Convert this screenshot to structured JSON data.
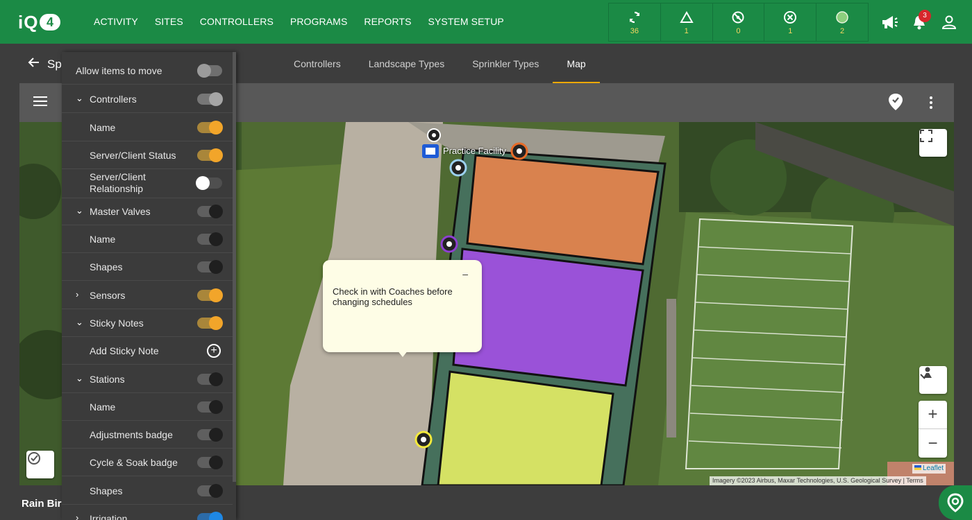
{
  "app": {
    "logo_text": "iQ",
    "logo_num": "4"
  },
  "nav": [
    "ACTIVITY",
    "SITES",
    "CONTROLLERS",
    "PROGRAMS",
    "REPORTS",
    "SYSTEM SETUP"
  ],
  "status": [
    {
      "icon": "sync-icon",
      "count": "36"
    },
    {
      "icon": "warning-triangle-icon",
      "count": "1"
    },
    {
      "icon": "prohibited-icon",
      "count": "0"
    },
    {
      "icon": "error-x-icon",
      "count": "1"
    },
    {
      "icon": "online-dot-icon",
      "count": "2"
    }
  ],
  "header_icons": {
    "announcements": "megaphone-icon",
    "notifications": "bell-icon",
    "notification_count": "3",
    "user": "user-icon"
  },
  "subheader": {
    "back_icon": "arrow-left-icon",
    "site_name": "Sp"
  },
  "tabs": [
    {
      "label": "Controllers",
      "active": false
    },
    {
      "label": "Landscape Types",
      "active": false
    },
    {
      "label": "Sprinkler Types",
      "active": false
    },
    {
      "label": "Map",
      "active": true
    }
  ],
  "panel": {
    "rows": [
      {
        "label": "Allow items to move",
        "level": "top",
        "chevron": "",
        "toggle": "off-grey"
      },
      {
        "label": "Controllers",
        "level": "section",
        "chevron": "down",
        "toggle": "on-grey"
      },
      {
        "label": "Name",
        "level": "child",
        "chevron": "",
        "toggle": "on"
      },
      {
        "label": "Server/Client Status",
        "level": "child",
        "chevron": "",
        "toggle": "on"
      },
      {
        "label": "Server/Client Relationship",
        "level": "child",
        "chevron": "",
        "toggle": "off-white"
      },
      {
        "label": "Master Valves",
        "level": "section",
        "chevron": "down",
        "toggle": "off-dark"
      },
      {
        "label": "Name",
        "level": "child",
        "chevron": "",
        "toggle": "off-dark"
      },
      {
        "label": "Shapes",
        "level": "child",
        "chevron": "",
        "toggle": "off-dark"
      },
      {
        "label": "Sensors",
        "level": "section",
        "chevron": "right",
        "toggle": "on"
      },
      {
        "label": "Sticky Notes",
        "level": "section",
        "chevron": "down",
        "toggle": "on"
      },
      {
        "label": "Add Sticky Note",
        "level": "child",
        "chevron": "",
        "toggle": "add"
      },
      {
        "label": "Stations",
        "level": "section",
        "chevron": "down",
        "toggle": "off-dark"
      },
      {
        "label": "Name",
        "level": "child",
        "chevron": "",
        "toggle": "off-dark"
      },
      {
        "label": "Adjustments badge",
        "level": "child",
        "chevron": "",
        "toggle": "off-dark"
      },
      {
        "label": "Cycle & Soak badge",
        "level": "child",
        "chevron": "",
        "toggle": "off-dark"
      },
      {
        "label": "Shapes",
        "level": "child",
        "chevron": "",
        "toggle": "off-dark"
      },
      {
        "label": "Irrigation",
        "level": "section",
        "chevron": "right",
        "toggle": "on-blue"
      }
    ]
  },
  "map": {
    "facility_label": "Practice Facility",
    "sticky_note_text": "Check in with Coaches before changing schedules",
    "sticky_minimize": "–",
    "attribution": "Imagery ©2023 Airbus, Maxar Technologies, U.S. Geological Survey",
    "terms": "Terms",
    "leaflet": "Leaflet",
    "zones": [
      {
        "name": "orange-zone",
        "color": "#d97a4a"
      },
      {
        "name": "purple-zone",
        "color": "#9b52d6"
      },
      {
        "name": "yellow-zone",
        "color": "#d4e05f"
      }
    ],
    "controls": {
      "fullscreen": "fullscreen-icon",
      "street_view": "street-view-icon",
      "zoom_in": "+",
      "zoom_out": "−",
      "layers": "layers-check-icon"
    }
  },
  "bottom_label": "Rain Bir",
  "colors": {
    "brand_green": "#1b8a45",
    "accent_orange": "#f2a52a",
    "status_yellow": "#f3d660"
  }
}
